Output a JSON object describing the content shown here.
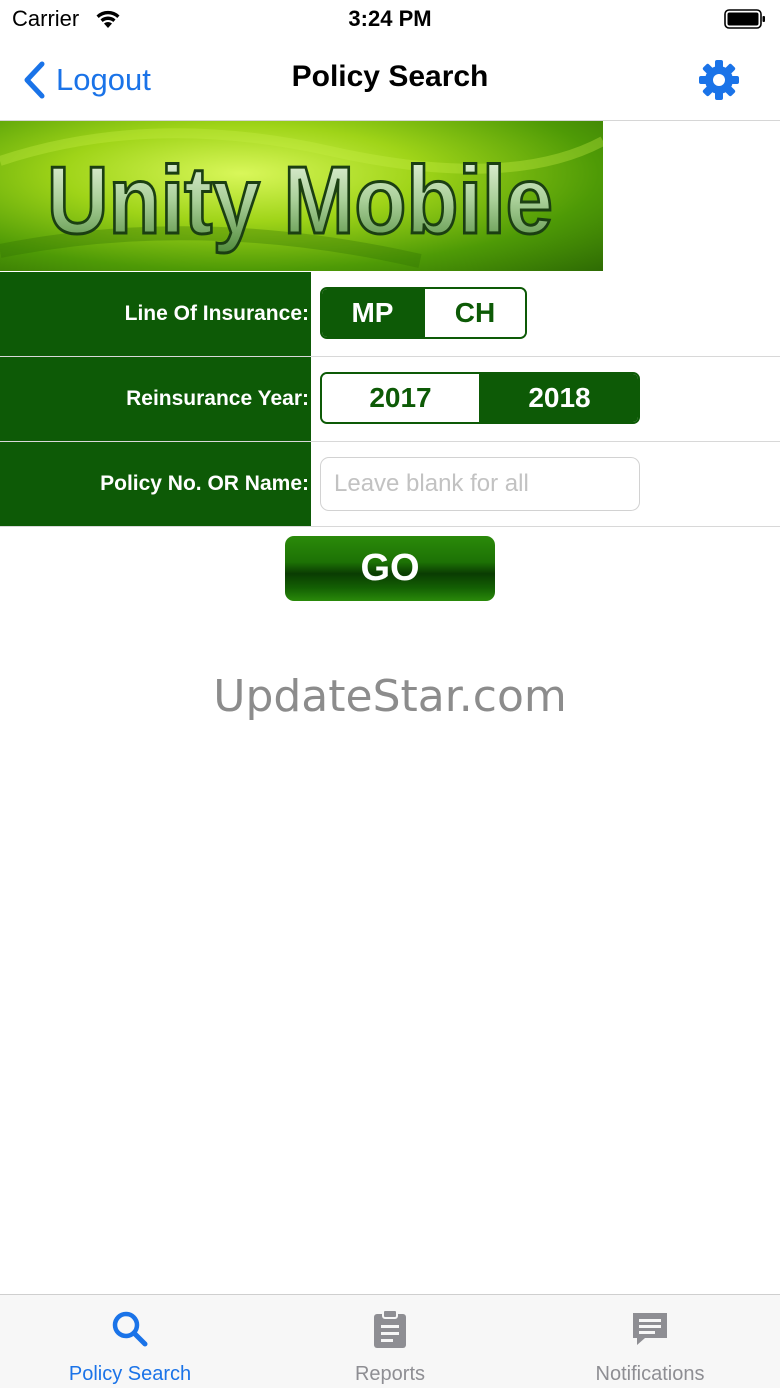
{
  "status_bar": {
    "carrier": "Carrier",
    "time": "3:24 PM"
  },
  "nav": {
    "back_label": "Logout",
    "title": "Policy Search",
    "settings_icon": "gear-icon"
  },
  "banner": {
    "text": "Unity Mobile"
  },
  "form": {
    "line_of_insurance": {
      "label": "Line Of Insurance:",
      "options": [
        "MP",
        "CH"
      ],
      "selected": "MP"
    },
    "reinsurance_year": {
      "label": "Reinsurance Year:",
      "options": [
        "2017",
        "2018"
      ],
      "selected": "2018"
    },
    "policy": {
      "label": "Policy No. OR Name:",
      "value": "",
      "placeholder": "Leave blank for all"
    }
  },
  "go_label": "GO",
  "watermark": "UpdateStar.com",
  "tabs": [
    {
      "label": "Policy Search",
      "icon": "search-icon",
      "active": true
    },
    {
      "label": "Reports",
      "icon": "clipboard-icon",
      "active": false
    },
    {
      "label": "Notifications",
      "icon": "chat-bubble-icon",
      "active": false
    }
  ],
  "colors": {
    "brand_green": "#0d5a06",
    "ios_blue": "#1a73e8",
    "inactive_gray": "#8e8e93"
  }
}
